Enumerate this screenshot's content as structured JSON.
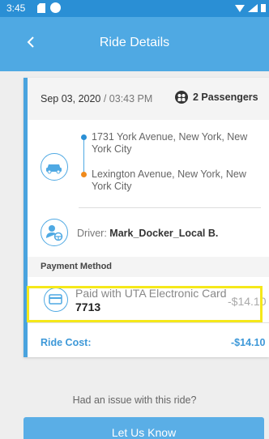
{
  "status_bar": {
    "time": "3:45"
  },
  "app_bar": {
    "title": "Ride Details",
    "back_icon": "back-chevron-icon"
  },
  "ride": {
    "date": "Sep 03, 2020",
    "date_sep": " / ",
    "time": "03:43 PM",
    "passengers": "2 Passengers",
    "pickup": "1731 York Avenue, New York, New York City",
    "dropoff": "Lexington Avenue, New York, New York City",
    "driver_label": "Driver: ",
    "driver_name": "Mark_Docker_Local B."
  },
  "payment": {
    "header": "Payment Method",
    "method": "Paid with UTA Electronic Card",
    "card_number": "7713",
    "amount": "-$14.10"
  },
  "cost": {
    "label": "Ride Cost:",
    "value": "-$14.10"
  },
  "issue": {
    "prompt": "Had an issue with this ride?",
    "button": "Let Us Know"
  },
  "colors": {
    "status_bar": "#2a8fd5",
    "app_bar": "#4fa9e3",
    "accent": "#3d98d8",
    "pickup_dot": "#2a8fd5",
    "dropoff_dot": "#f08a1c",
    "highlight": "#f5e81a"
  }
}
